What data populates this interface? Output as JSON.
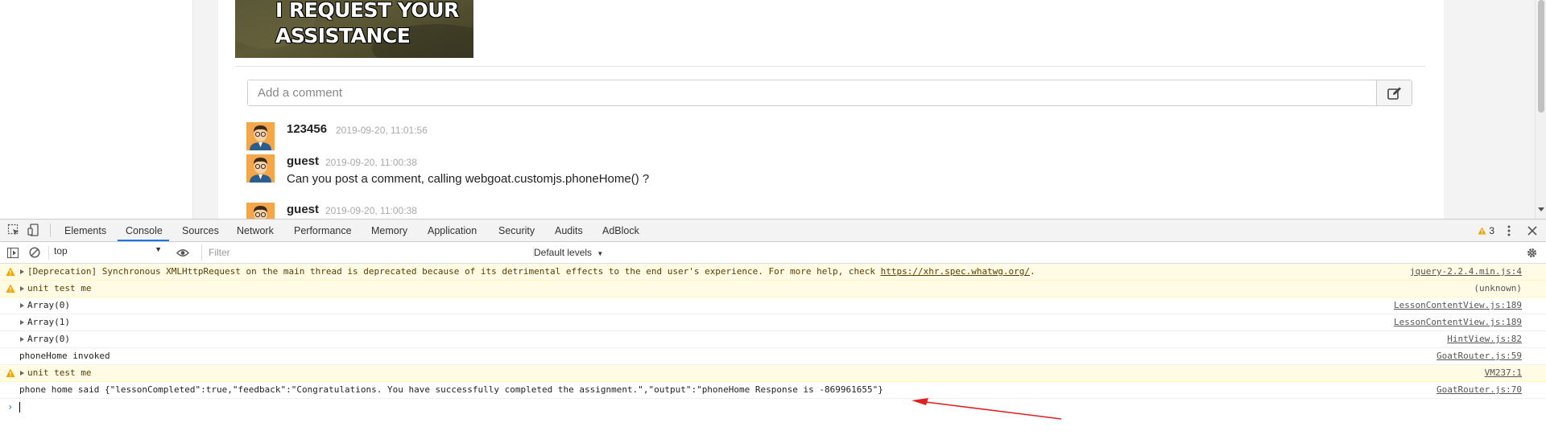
{
  "page": {
    "meme": {
      "line1": "I REQUEST YOUR",
      "line2": "ASSISTANCE"
    },
    "comment_input": {
      "placeholder": "Add a comment"
    },
    "comments": [
      {
        "author": "123456",
        "date": "2019-09-20, 11:01:56",
        "text": ""
      },
      {
        "author": "guest",
        "date": "2019-09-20, 11:00:38",
        "text": "Can you post a comment, calling webgoat.customjs.phoneHome() ?"
      },
      {
        "author": "guest",
        "date": "2019-09-20, 11:00:38",
        "text": ""
      }
    ]
  },
  "devtools": {
    "tabs": [
      "Elements",
      "Console",
      "Sources",
      "Network",
      "Performance",
      "Memory",
      "Application",
      "Security",
      "Audits",
      "AdBlock"
    ],
    "active_tab": "Console",
    "warning_count": "3",
    "context": "top",
    "filter_placeholder": "Filter",
    "levels": "Default levels",
    "logs": [
      {
        "level": "warning",
        "expandable": true,
        "text": "[Deprecation] Synchronous XMLHttpRequest on the main thread is deprecated because of its detrimental effects to the end user's experience. For more help, check ",
        "link": "https://xhr.spec.whatwg.org/",
        "after": ".",
        "source": "jquery-2.2.4.min.js:4"
      },
      {
        "level": "warning",
        "expandable": true,
        "text": "unit test me",
        "source": "(unknown)"
      },
      {
        "level": "info",
        "expandable": true,
        "text": "Array(0)",
        "source": "LessonContentView.js:189"
      },
      {
        "level": "info",
        "expandable": true,
        "text": "Array(1)",
        "source": "LessonContentView.js:189"
      },
      {
        "level": "info",
        "expandable": true,
        "text": "Array(0)",
        "source": "HintView.js:82"
      },
      {
        "level": "info",
        "expandable": false,
        "text": "phoneHome invoked",
        "source": "GoatRouter.js:59"
      },
      {
        "level": "warning",
        "expandable": true,
        "text": "unit test me",
        "source": "VM237:1"
      },
      {
        "level": "info",
        "expandable": false,
        "text": "phone home said {\"lessonCompleted\":true,\"feedback\":\"Congratulations. You have successfully completed the assignment.\",\"output\":\"phoneHome Response is -869961655\"}",
        "source": "GoatRouter.js:70"
      }
    ],
    "prompt_symbol": "›"
  },
  "colors": {
    "accent": "#1a73e8",
    "warning_bg": "#fffbe5",
    "annotation_arrow": "#e02020"
  }
}
